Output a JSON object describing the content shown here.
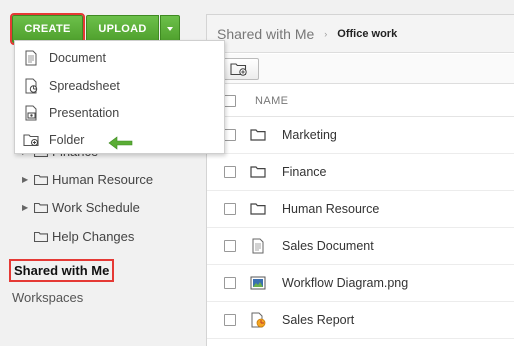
{
  "toolbar": {
    "create_label": "CREATE",
    "upload_label": "UPLOAD"
  },
  "create_menu": {
    "items": [
      {
        "label": "Document",
        "icon": "document-icon"
      },
      {
        "label": "Spreadsheet",
        "icon": "spreadsheet-icon"
      },
      {
        "label": "Presentation",
        "icon": "presentation-icon"
      },
      {
        "label": "Folder",
        "icon": "folder-add-icon"
      }
    ]
  },
  "sidebar": {
    "tree": [
      {
        "label": "Finance",
        "expandable": true
      },
      {
        "label": "Human Resource",
        "expandable": true
      },
      {
        "label": "Work Schedule",
        "expandable": true
      },
      {
        "label": "Help Changes",
        "expandable": false
      }
    ],
    "shared_with_me": "Shared with Me",
    "workspaces": "Workspaces"
  },
  "breadcrumb": {
    "root": "Shared with Me",
    "separator": "›",
    "current": "Office work"
  },
  "table": {
    "column_name": "NAME",
    "rows": [
      {
        "name": "Marketing",
        "type": "folder"
      },
      {
        "name": "Finance",
        "type": "folder"
      },
      {
        "name": "Human Resource",
        "type": "folder"
      },
      {
        "name": "Sales Document",
        "type": "document"
      },
      {
        "name": "Workflow Diagram.png",
        "type": "image"
      },
      {
        "name": "Sales Report",
        "type": "report"
      }
    ]
  },
  "colors": {
    "accent_green": "#5aad35",
    "highlight_red": "#e53935"
  }
}
